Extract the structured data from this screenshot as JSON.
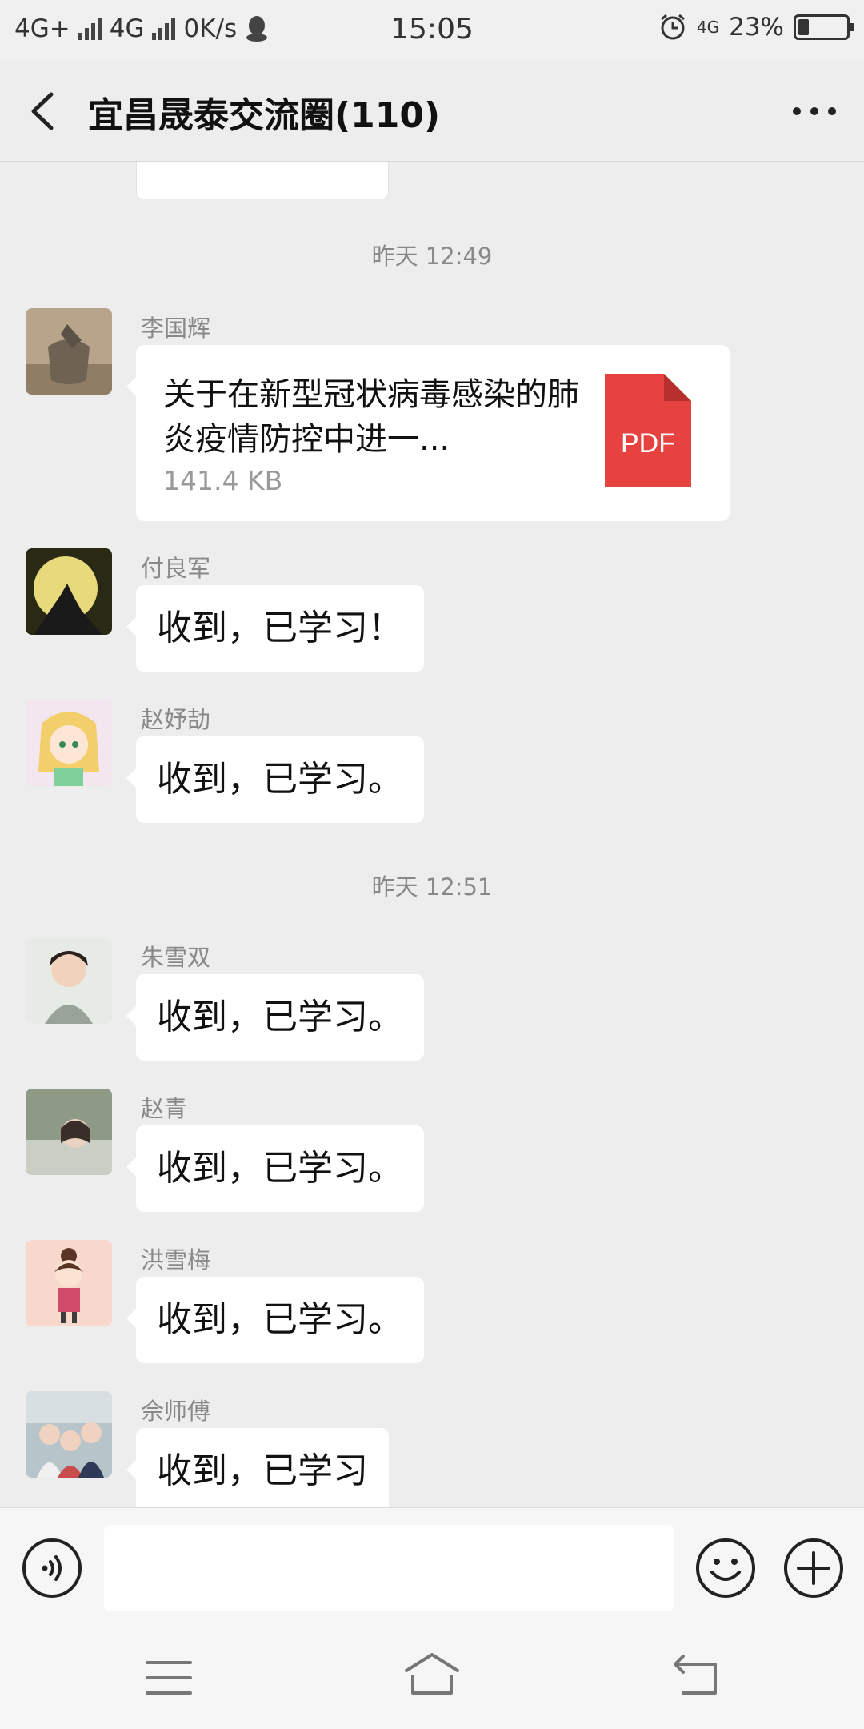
{
  "status_bar": {
    "network1": "4G+",
    "network2": "4G",
    "speed": "0K/s",
    "time": "15:05",
    "network3": "4G",
    "battery_text": "23%",
    "battery_level": 0.23
  },
  "header": {
    "title": "宜昌晟泰交流圈(110)"
  },
  "chat": {
    "timestamps": [
      "昨天 12:49",
      "昨天 12:51"
    ],
    "messages": [
      {
        "sender": "李国辉",
        "type": "file",
        "file_name": "关于在新型冠状病毒感染的肺炎疫情防控中进一...",
        "file_size": "141.4 KB",
        "file_badge": "PDF"
      },
      {
        "sender": "付良军",
        "type": "text",
        "text": "收到，已学习！"
      },
      {
        "sender": "赵妤劼",
        "type": "text",
        "text": "收到，已学习。"
      },
      {
        "sender": "朱雪双",
        "type": "text",
        "text": "收到，已学习。"
      },
      {
        "sender": "赵青",
        "type": "text",
        "text": "收到，已学习。"
      },
      {
        "sender": "洪雪梅",
        "type": "text",
        "text": "收到，已学习。"
      },
      {
        "sender": "佘师傅",
        "type": "text",
        "text": "收到，已学习"
      }
    ]
  },
  "colors": {
    "background": "#ededed",
    "bubble": "#ffffff",
    "pdf_red": "#e64340",
    "meta_text": "#888888"
  },
  "icons": [
    "back-icon",
    "more-icon",
    "voice-icon",
    "emoji-icon",
    "plus-icon",
    "menu-icon",
    "home-icon",
    "return-icon",
    "pdf-icon"
  ]
}
